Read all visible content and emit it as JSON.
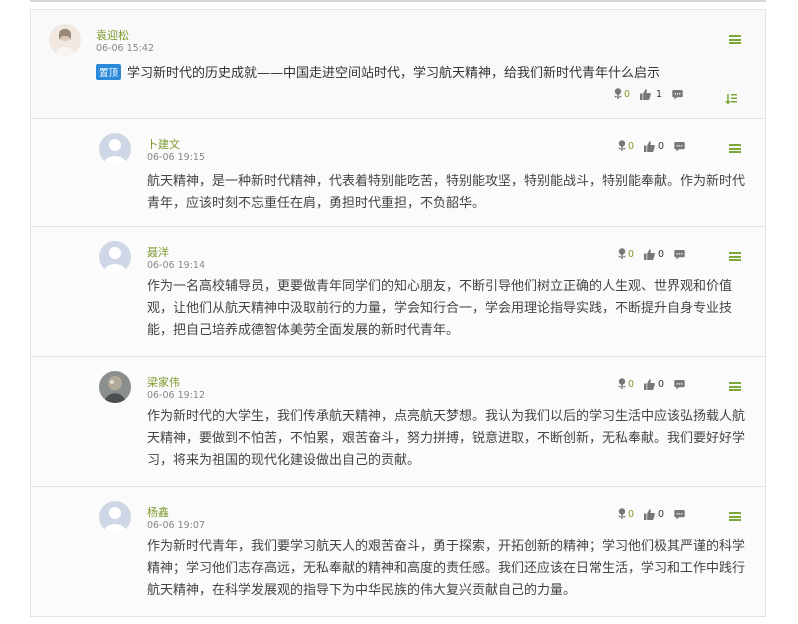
{
  "main_post": {
    "author": "袁迎松",
    "date": "06-06 15:42",
    "badge": "置顶",
    "title": "学习新时代的历史成就——中国走进空间站时代，学习航天精神，给我们新时代青年什么启示",
    "flowers": "0",
    "likes": "1"
  },
  "replies": [
    {
      "author": "卜建文",
      "date": "06-06 19:15",
      "flowers": "0",
      "likes": "0",
      "text": "航天精神，是一种新时代精神，代表着特别能吃苦，特别能攻坚，特别能战斗，特别能奉献。作为新时代青年，应该时刻不忘重任在肩，勇担时代重担，不负韶华。"
    },
    {
      "author": "聂洋",
      "date": "06-06 19:14",
      "flowers": "0",
      "likes": "0",
      "text": "作为一名高校辅导员，更要做青年同学们的知心朋友，不断引导他们树立正确的人生观、世界观和价值观，让他们从航天精神中汲取前行的力量，学会知行合一，学会用理论指导实践，不断提升自身专业技能，把自己培养成德智体美劳全面发展的新时代青年。"
    },
    {
      "author": "梁家伟",
      "date": "06-06 19:12",
      "flowers": "0",
      "likes": "0",
      "text": "作为新时代的大学生，我们传承航天精神，点亮航天梦想。我认为我们以后的学习生活中应该弘扬载人航天精神，要做到不怕苦，不怕累，艰苦奋斗，努力拼搏，锐意进取，不断创新，无私奉献。我们要好好学习，将来为祖国的现代化建设做出自己的贡献。"
    },
    {
      "author": "杨鑫",
      "date": "06-06 19:07",
      "flowers": "0",
      "likes": "0",
      "text": "作为新时代青年，我们要学习航天人的艰苦奋斗，勇于探索，开拓创新的精神；学习他们极其严谨的科学精神；学习他们志存高远，无私奉献的精神和高度的责任感。我们还应该在日常生活，学习和工作中践行航天精神，在科学发展观的指导下为中华民族的伟大复兴贡献自己的力量。"
    }
  ],
  "colors": {
    "accent_green": "#7d9a2c",
    "badge_blue": "#2b8ad8",
    "icon_gray": "#777777"
  }
}
